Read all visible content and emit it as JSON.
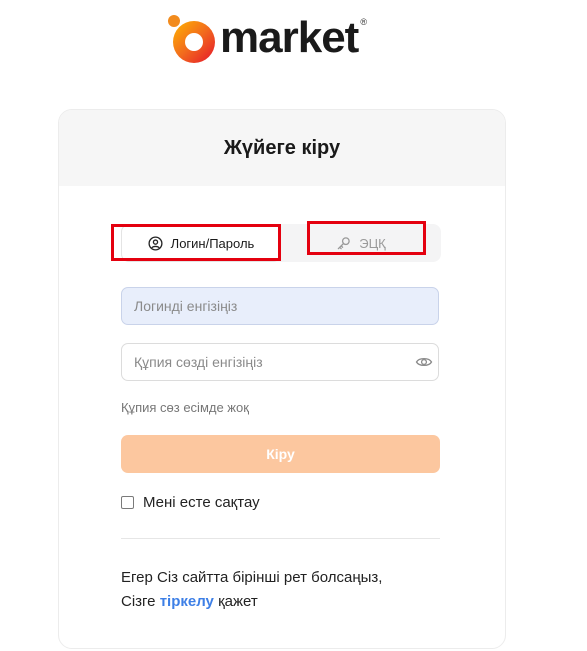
{
  "brand": {
    "name": "market",
    "reg_mark": "®",
    "colors": {
      "accent_orange": "#f26b1d",
      "accent_red": "#e5142b",
      "accent_yellow": "#ffb400"
    }
  },
  "login_card": {
    "title": "Жүйеге кіру",
    "tabs": [
      {
        "label": "Логин/Пароль",
        "icon": "user-circle-icon",
        "active": true
      },
      {
        "label": "ЭЦҚ",
        "icon": "key-icon",
        "active": false
      }
    ],
    "login_input": {
      "placeholder": "Логинді енгізіңіз",
      "value": ""
    },
    "password_input": {
      "placeholder": "Құпия сөзді енгізіңіз",
      "value": "",
      "icon": "eye-icon"
    },
    "forgot_password": "Құпия сөз есімде жоқ",
    "submit_label": "Кіру",
    "remember_me": {
      "label": "Мені есте сақтау",
      "checked": false
    },
    "first_time": {
      "line1": "Егер Сіз сайтта бірінші рет болсаңыз,",
      "line2_before": "Сізге",
      "link_text": "тіркелу",
      "line2_after": "қажет"
    }
  }
}
